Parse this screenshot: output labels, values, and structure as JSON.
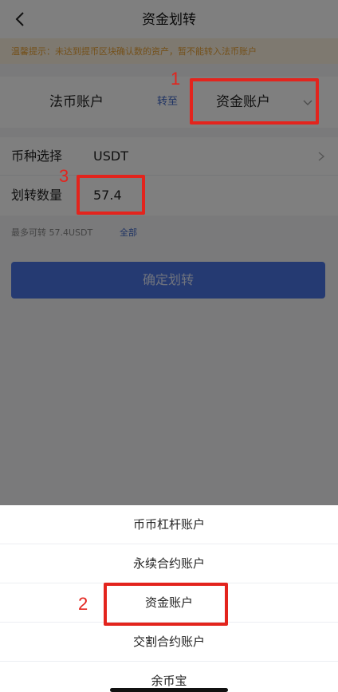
{
  "header": {
    "title": "资金划转",
    "back_icon": "chevron-left-icon"
  },
  "notice": {
    "text": "温馨提示：未达到提币区块确认数的资产，暂不能转入法币账户"
  },
  "transfer": {
    "from_account": "法币账户",
    "to_label": "转至",
    "to_account": "资金账户"
  },
  "coin": {
    "label": "币种选择",
    "value": "USDT"
  },
  "amount": {
    "label": "划转数量",
    "value": "57.4"
  },
  "max": {
    "text": "最多可转 57.4USDT",
    "all_label": "全部"
  },
  "confirm_label": "确定划转",
  "sheet": {
    "items": [
      {
        "label": "币币杠杆账户"
      },
      {
        "label": "永续合约账户"
      },
      {
        "label": "资金账户"
      },
      {
        "label": "交割合约账户"
      },
      {
        "label": "余币宝"
      }
    ]
  },
  "annotations": {
    "mark1": "1",
    "mark2": "2",
    "mark3": "3"
  },
  "colors": {
    "accent": "#3f66c6",
    "button": "#4a74e4",
    "highlight": "#e3241d",
    "notice_text": "#e9a236"
  }
}
